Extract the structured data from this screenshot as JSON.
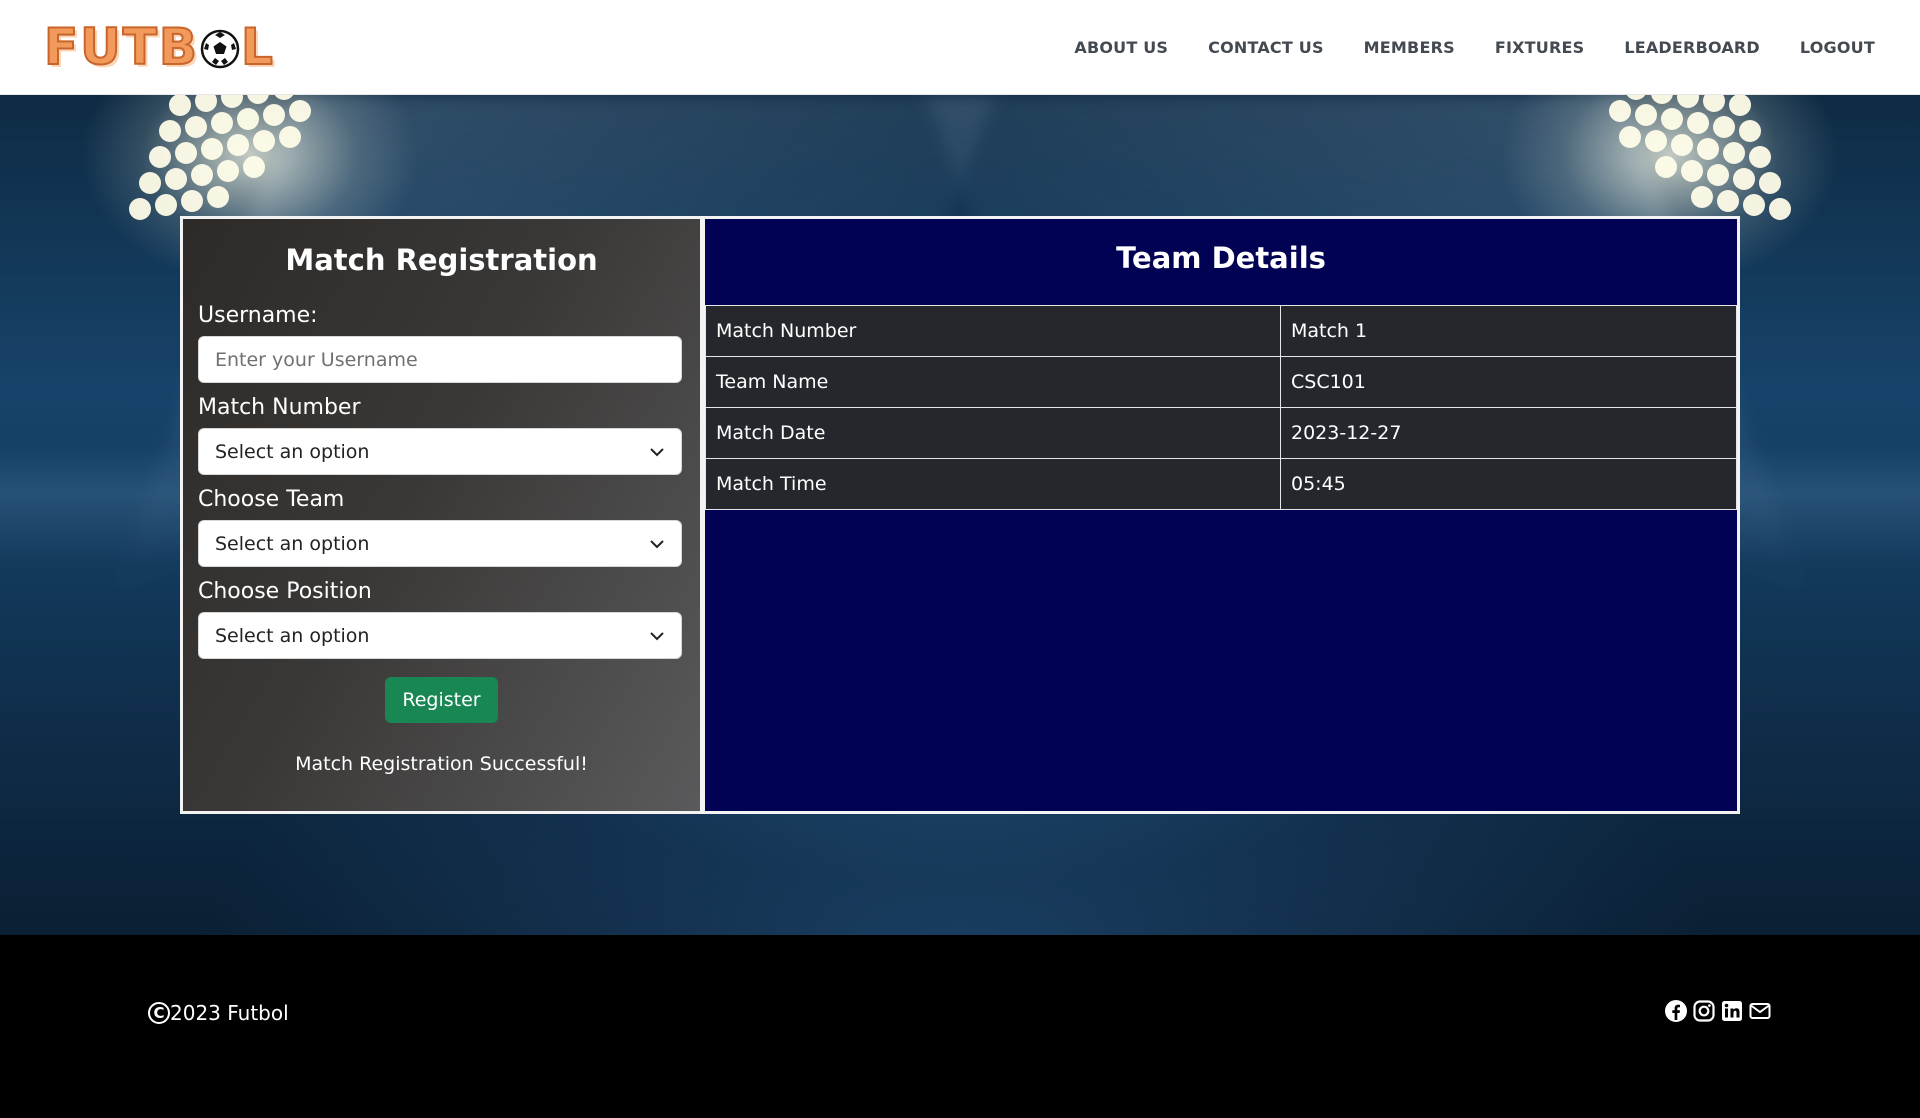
{
  "brand": {
    "logo_text_pre": "FUTB",
    "logo_text_post": "L",
    "ball_icon": "soccer-ball-icon"
  },
  "nav": {
    "items": [
      {
        "label": "ABOUT US"
      },
      {
        "label": "CONTACT US"
      },
      {
        "label": "MEMBERS"
      },
      {
        "label": "FIXTURES"
      },
      {
        "label": "LEADERBOARD"
      },
      {
        "label": "LOGOUT"
      }
    ]
  },
  "registration": {
    "title": "Match Registration",
    "username_label": "Username:",
    "username_placeholder": "Enter your Username",
    "match_number_label": "Match Number",
    "match_number_value": "Select an option",
    "team_label": "Choose Team",
    "team_value": "Select an option",
    "position_label": "Choose Position",
    "position_value": "Select an option",
    "register_label": "Register",
    "success_message": "Match Registration Successful!"
  },
  "team_details": {
    "title": "Team Details",
    "rows": [
      {
        "key": "Match Number",
        "value": "Match 1"
      },
      {
        "key": "Team Name",
        "value": "CSC101"
      },
      {
        "key": "Match Date",
        "value": "2023-12-27"
      },
      {
        "key": "Match Time",
        "value": "05:45"
      }
    ]
  },
  "footer": {
    "copyright_symbol": "C",
    "copyright_text": "2023 Futbol",
    "social_icons": [
      "facebook-icon",
      "instagram-icon",
      "linkedin-icon",
      "email-icon"
    ]
  },
  "colors": {
    "accent_orange": "#f19a5b",
    "team_panel_bg": "#020255",
    "register_green": "#198754",
    "table_row_bg": "#25272c"
  }
}
